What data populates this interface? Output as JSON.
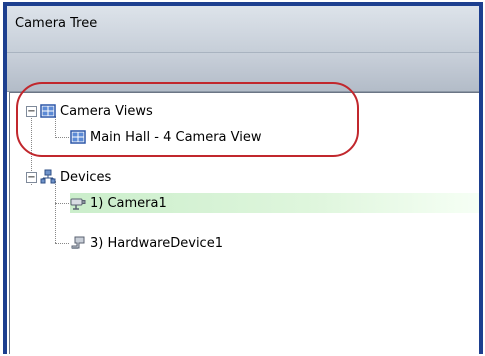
{
  "panel": {
    "title": "Camera Tree"
  },
  "tree": {
    "nodes": [
      {
        "label": "Camera Views",
        "icon": "camera-view-icon"
      },
      {
        "label": "Main Hall - 4 Camera View",
        "icon": "camera-view-icon"
      },
      {
        "label": "Devices",
        "icon": "network-devices-icon"
      },
      {
        "label": "1) Camera1",
        "icon": "camera-icon",
        "highlighted": true
      },
      {
        "label": "3) HardwareDevice1",
        "icon": "hardware-device-icon"
      }
    ]
  },
  "colors": {
    "frame": "#1d3f8f",
    "highlight": "#cbeecb",
    "annotation": "#c1272d"
  }
}
